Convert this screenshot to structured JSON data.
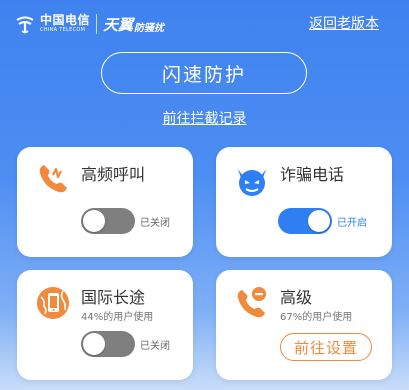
{
  "header": {
    "logo_main": "中国电信",
    "logo_sub": "CHINA TELECOM",
    "logo_brand": "天翼",
    "logo_brand_sub": "防骚扰",
    "back_link": "返回老版本"
  },
  "main": {
    "protect_button": "闪速防护",
    "record_link": "前往拦截记录"
  },
  "cards": [
    {
      "title": "高频呼叫",
      "subtitle": "",
      "toggle_state": "off",
      "status": "已关闭",
      "icon": "phone-frequent-icon",
      "color": "#f08a3c"
    },
    {
      "title": "诈骗电话",
      "subtitle": "",
      "toggle_state": "on",
      "status": "已开启",
      "icon": "devil-fraud-icon",
      "color": "#2f7ff2"
    },
    {
      "title": "国际长途",
      "subtitle": "44%的用户使用",
      "toggle_state": "off",
      "status": "已关闭",
      "icon": "globe-phone-icon",
      "color": "#f08a3c"
    },
    {
      "title": "高级",
      "subtitle": "67%的用户使用",
      "button": "前往设置",
      "icon": "phone-minus-icon",
      "color": "#f08a3c"
    }
  ],
  "colors": {
    "accent_blue": "#2f7ff2",
    "accent_orange": "#f08a3c",
    "toggle_off": "#7f7f7f"
  }
}
